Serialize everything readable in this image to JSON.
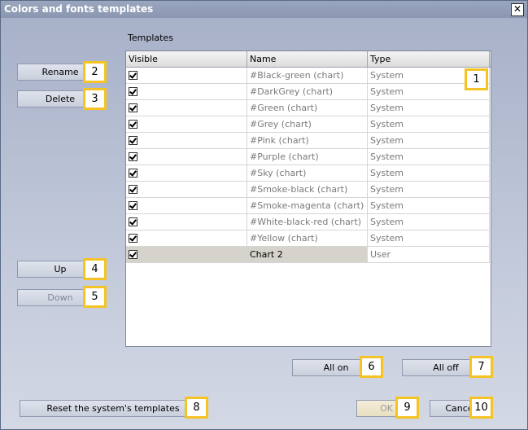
{
  "window": {
    "title": "Colors and fonts templates",
    "close_glyph": "✕"
  },
  "group_label": "Templates",
  "columns": {
    "visible": "Visible",
    "name": "Name",
    "type": "Type"
  },
  "rows": [
    {
      "visible": true,
      "name": "#Black-green (chart)",
      "type": "System"
    },
    {
      "visible": true,
      "name": "#DarkGrey (chart)",
      "type": "System"
    },
    {
      "visible": true,
      "name": "#Green (chart)",
      "type": "System"
    },
    {
      "visible": true,
      "name": "#Grey (chart)",
      "type": "System"
    },
    {
      "visible": true,
      "name": "#Pink (chart)",
      "type": "System"
    },
    {
      "visible": true,
      "name": "#Purple (chart)",
      "type": "System"
    },
    {
      "visible": true,
      "name": "#Sky (chart)",
      "type": "System"
    },
    {
      "visible": true,
      "name": "#Smoke-black (chart)",
      "type": "System"
    },
    {
      "visible": true,
      "name": "#Smoke-magenta (chart)",
      "type": "System"
    },
    {
      "visible": true,
      "name": "#White-black-red (chart)",
      "type": "System"
    },
    {
      "visible": true,
      "name": "#Yellow (chart)",
      "type": "System"
    },
    {
      "visible": true,
      "name": "Chart 2",
      "type": "User",
      "selected": true
    }
  ],
  "buttons": {
    "rename": "Rename",
    "delete": "Delete",
    "up": "Up",
    "down": "Down",
    "all_on": "All on",
    "all_off": "All off",
    "reset": "Reset the system's templates",
    "ok": "OK",
    "cancel": "Cancel"
  },
  "badges": {
    "b1": "1",
    "b2": "2",
    "b3": "3",
    "b4": "4",
    "b5": "5",
    "b6": "6",
    "b7": "7",
    "b8": "8",
    "b9": "9",
    "b10": "10"
  },
  "colors": {
    "badge_border": "#f5c324",
    "selected_row": "#d6d2cc"
  }
}
